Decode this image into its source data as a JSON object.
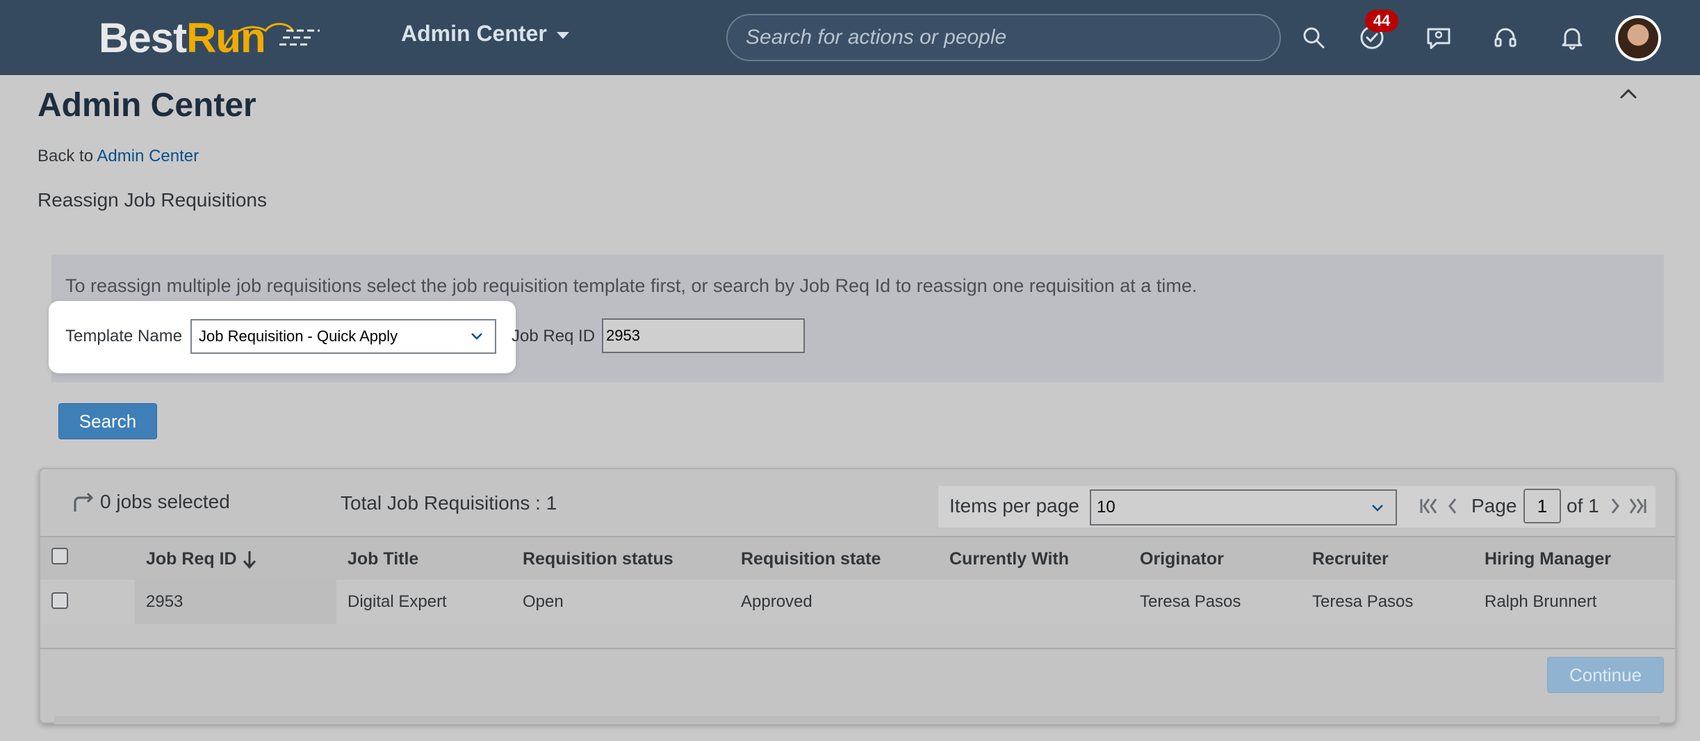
{
  "header": {
    "logo": {
      "part1": "Best",
      "part2": "Run"
    },
    "menu_label": "Admin Center",
    "search_placeholder": "Search for actions or people",
    "notification_count": "44",
    "icons": [
      "search-icon",
      "check-circle-icon",
      "people-chat-icon",
      "headset-icon",
      "bell-icon"
    ]
  },
  "page": {
    "title": "Admin Center",
    "back_prefix": "Back to",
    "back_link": "Admin Center",
    "subtitle": "Reassign Job Requisitions"
  },
  "filters": {
    "instructions": "To reassign multiple job requisitions select the job requisition template first, or search by Job Req Id to reassign one requisition at a time.",
    "template_label": "Template Name",
    "template_value": "Job Requisition - Quick Apply",
    "jobreq_label": "Job Req ID",
    "jobreq_value": "2953",
    "search_button": "Search"
  },
  "results": {
    "selected_text": "0 jobs selected",
    "total_text": "Total Job Requisitions : 1",
    "items_per_page_label": "Items per page",
    "items_per_page_value": "10",
    "page_label": "Page",
    "page_value": "1",
    "of_label": "of 1",
    "columns": {
      "job_req_id": "Job Req ID",
      "job_title": "Job Title",
      "req_status": "Requisition status",
      "req_state": "Requisition state",
      "currently_with": "Currently With",
      "originator": "Originator",
      "recruiter": "Recruiter",
      "hiring_manager": "Hiring Manager"
    },
    "rows": [
      {
        "job_req_id": "2953",
        "job_title": "Digital Expert",
        "req_status": "Open",
        "req_state": "Approved",
        "currently_with": "",
        "originator": "Teresa Pasos",
        "recruiter": "Teresa Pasos",
        "hiring_manager": "Ralph Brunnert"
      }
    ],
    "continue_button": "Continue"
  },
  "colors": {
    "shell": "#354a5f",
    "accent": "#0a5089",
    "button": "#3f7fb8",
    "badge": "#bb0000",
    "logo_orange": "#f0ab00"
  }
}
